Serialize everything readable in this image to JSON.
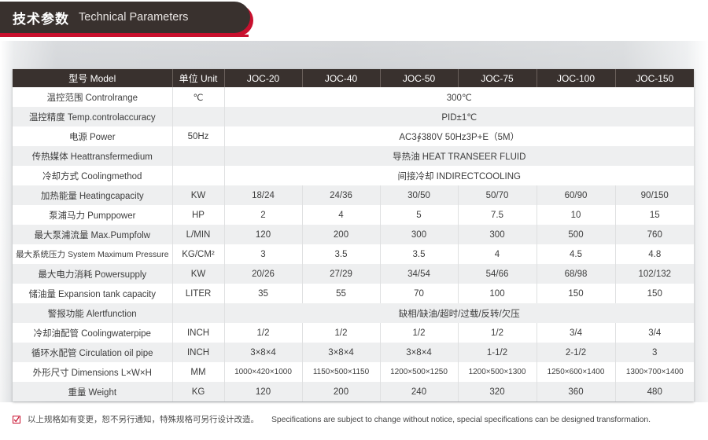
{
  "banner": {
    "title_cn": "技术参数",
    "title_en": "Technical Parameters"
  },
  "colors": {
    "banner_dark": "#39312e",
    "accent_red": "#c8102e",
    "header_bg": "#39312e",
    "row_even_bg": "#eeeff0",
    "row_odd_bg": "#ffffff"
  },
  "table": {
    "headers": [
      "型号 Model",
      "单位 Unit",
      "JOC-20",
      "JOC-40",
      "JOC-50",
      "JOC-75",
      "JOC-100",
      "JOC-150"
    ],
    "rows": [
      {
        "label_cn": "温控范围",
        "label_en": "Controlrange",
        "unit": "℃",
        "merged": true,
        "merged_value": "300℃",
        "values": []
      },
      {
        "label_cn": "温控精度",
        "label_en": "Temp.controlaccuracy",
        "unit": "",
        "merged": true,
        "merged_value": "PID±1℃",
        "values": []
      },
      {
        "label_cn": "电源",
        "label_en": "Power",
        "unit": "50Hz",
        "merged": true,
        "merged_value": "AC3∮380V 50Hz3P+E（5M）",
        "values": []
      },
      {
        "label_cn": "传热媒体",
        "label_en": "Heattransfermedium",
        "unit": "",
        "merged": true,
        "merged_value": "导热油 HEAT TRANSEER FLUID",
        "values": []
      },
      {
        "label_cn": "冷却方式",
        "label_en": "Coolingmethod",
        "unit": "",
        "merged": true,
        "merged_value": "间接冷却 INDIRECTCOOLING",
        "values": []
      },
      {
        "label_cn": "加热能量",
        "label_en": "Heatingcapacity",
        "unit": "KW",
        "merged": false,
        "values": [
          "18/24",
          "24/36",
          "30/50",
          "50/70",
          "60/90",
          "90/150"
        ]
      },
      {
        "label_cn": "泵浦马力",
        "label_en": "Pumppower",
        "unit": "HP",
        "merged": false,
        "values": [
          "2",
          "4",
          "5",
          "7.5",
          "10",
          "15"
        ]
      },
      {
        "label_cn": "最大泵浦流量",
        "label_en": "Max.Pumpfolw",
        "unit": "L/MIN",
        "merged": false,
        "values": [
          "120",
          "200",
          "300",
          "300",
          "500",
          "760"
        ]
      },
      {
        "label_cn": "最大系统压力",
        "label_en": "System Maximum Pressure",
        "unit": "KG/CM²",
        "merged": false,
        "small_label": true,
        "values": [
          "3",
          "3.5",
          "3.5",
          "4",
          "4.5",
          "4.8"
        ]
      },
      {
        "label_cn": "最大电力消耗",
        "label_en": "Powersupply",
        "unit": "KW",
        "merged": false,
        "values": [
          "20/26",
          "27/29",
          "34/54",
          "54/66",
          "68/98",
          "102/132"
        ]
      },
      {
        "label_cn": "储油量",
        "label_en": "Expansion tank capacity",
        "unit": "LITER",
        "merged": false,
        "values": [
          "35",
          "55",
          "70",
          "100",
          "150",
          "150"
        ]
      },
      {
        "label_cn": "警报功能",
        "label_en": "Alertfunction",
        "unit": "",
        "merged": true,
        "merged_value": "缺相/缺油/超时/过载/反转/欠压",
        "values": []
      },
      {
        "label_cn": "冷却油配管",
        "label_en": "Coolingwaterpipe",
        "unit": "INCH",
        "merged": false,
        "values": [
          "1/2",
          "1/2",
          "1/2",
          "1/2",
          "3/4",
          "3/4"
        ]
      },
      {
        "label_cn": "循环水配管",
        "label_en": "Circulation oil pipe",
        "unit": "INCH",
        "merged": false,
        "values": [
          "3×8×4",
          "3×8×4",
          "3×8×4",
          "1-1/2",
          "2-1/2",
          "3"
        ]
      },
      {
        "label_cn": "外形尺寸",
        "label_en": "Dimensions L×W×H",
        "unit": "MM",
        "merged": false,
        "small_values": true,
        "values": [
          "1000×420×1000",
          "1150×500×1150",
          "1200×500×1250",
          "1200×500×1300",
          "1250×600×1400",
          "1300×700×1400"
        ]
      },
      {
        "label_cn": "重量",
        "label_en": "Weight",
        "unit": "KG",
        "merged": false,
        "values": [
          "120",
          "200",
          "240",
          "320",
          "360",
          "480"
        ]
      }
    ]
  },
  "footnote": {
    "icon": "check-box-icon",
    "text_cn": "以上规格如有变更，恕不另行通知，特殊规格可另行设计改造。",
    "text_en": "Specifications are subject to change without notice, special specifications can be designed transformation."
  }
}
